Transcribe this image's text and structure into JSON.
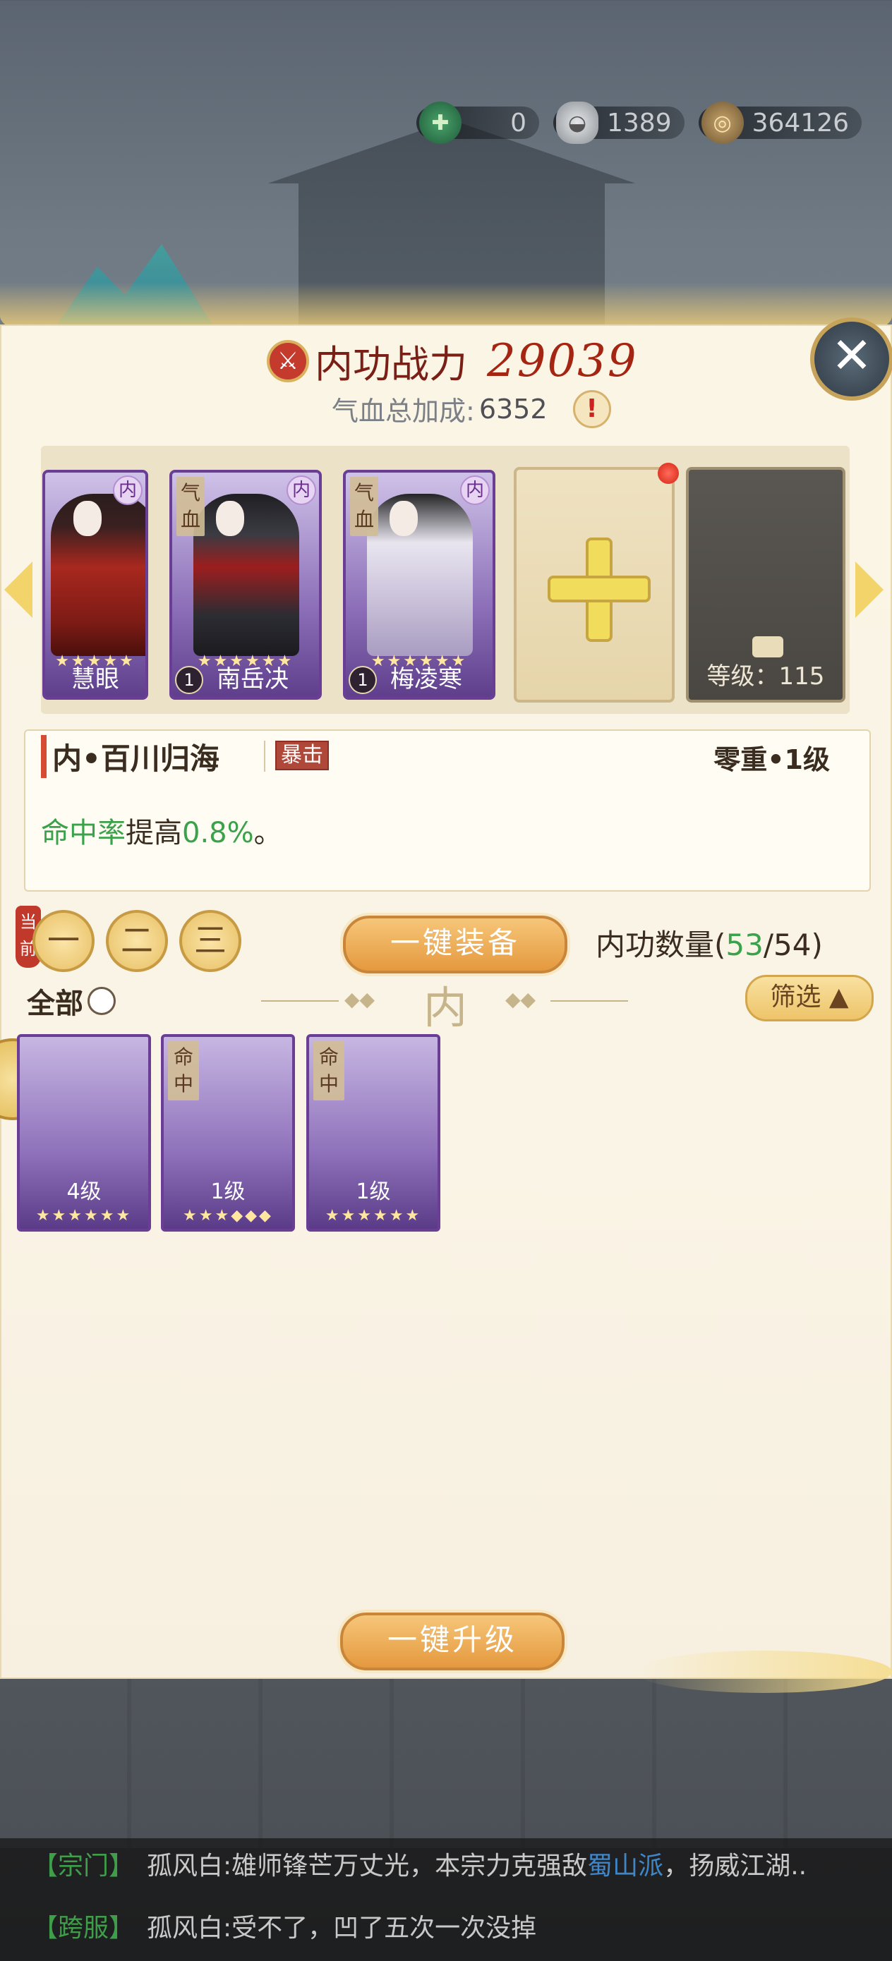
{
  "currency": {
    "jade": "0",
    "silver": "1389",
    "coin": "364126"
  },
  "header": {
    "power_label": "内功战力",
    "power_value": "29039",
    "hp_label": "气血总加成:",
    "hp_value": "6352",
    "close_symbol": "✕",
    "warn_symbol": "!"
  },
  "equipped": [
    {
      "name": "慧眼",
      "stars": "★★★★★",
      "tag": "内",
      "art": "red"
    },
    {
      "name": "南岳决",
      "stars": "★★★★★★",
      "tag": "内",
      "vert": "气血",
      "level": "1",
      "art": "dark"
    },
    {
      "name": "梅凌寒",
      "stars": "★★★★★★",
      "tag": "内",
      "vert": "气血",
      "level": "1",
      "art": "pale"
    }
  ],
  "locked_slot": {
    "label": "等级：115"
  },
  "detail": {
    "name": "内•百川归海",
    "type_tag": "暴击",
    "grade": "零重•1级",
    "desc_stat": "命中率",
    "desc_mid": "提高",
    "desc_value": "0.8%",
    "desc_end": "。"
  },
  "tabs": {
    "now_badge": "当前",
    "t1": "一",
    "t2": "二",
    "t3": "三"
  },
  "buttons": {
    "equip_all": "一键装备",
    "upgrade_all": "一键升级",
    "filter": "筛选"
  },
  "count": {
    "label": "内功数量(",
    "current": "53",
    "total": "/54)"
  },
  "filter_all": "全部",
  "divider": "内",
  "inventory": [
    {
      "level": "4级",
      "stars": "★★★★★★",
      "art": "red",
      "vert": ""
    },
    {
      "level": "1级",
      "stars": "★★★◆◆◆",
      "art": "white",
      "vert": "命中"
    },
    {
      "level": "1级",
      "stars": "★★★★★★",
      "art": "red",
      "vert": "命中"
    }
  ],
  "chat": [
    {
      "channel": "【宗门】",
      "name": "孤风白:",
      "text1": "雄师锋芒万丈光，本宗力克强敌",
      "highlight": "蜀山派",
      "text2": "，扬威江湖.."
    },
    {
      "channel": "【跨服】",
      "name": "孤风白:",
      "text1": "受不了，凹了五次一次没掉",
      "highlight": "",
      "text2": ""
    }
  ]
}
